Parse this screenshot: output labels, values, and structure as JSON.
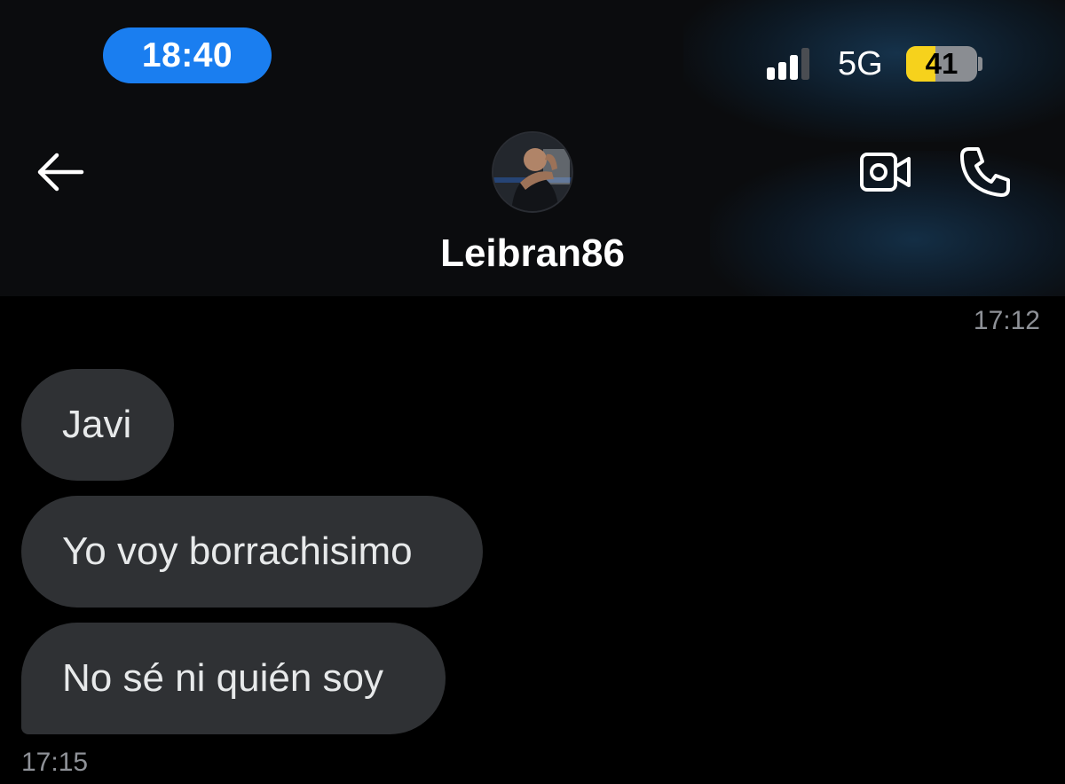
{
  "status_bar": {
    "time": "18:40",
    "network": "5G",
    "battery": "41",
    "battery_level": 0.41,
    "signal_bars": 3,
    "signal_bars_total": 4
  },
  "header": {
    "contact_name": "Leibran86",
    "icons": {
      "back": "arrow-left-icon",
      "video": "video-camera-icon",
      "call": "phone-icon"
    }
  },
  "messages": {
    "timestamp_top": "17:12",
    "items": [
      {
        "text": "Javi",
        "direction": "incoming"
      },
      {
        "text": "Yo voy borrachisimo",
        "direction": "incoming"
      },
      {
        "text": "No sé ni quién soy",
        "direction": "incoming"
      }
    ],
    "timestamp_bottom": "17:15"
  },
  "colors": {
    "background": "#000000",
    "header_background": "#0b0c0e",
    "time_pill": "#1a7ef0",
    "bubble": "#2f3134",
    "bubble_text": "#e7e9ea",
    "timestamp": "#8e9197",
    "battery_fill": "#f6d21c"
  }
}
